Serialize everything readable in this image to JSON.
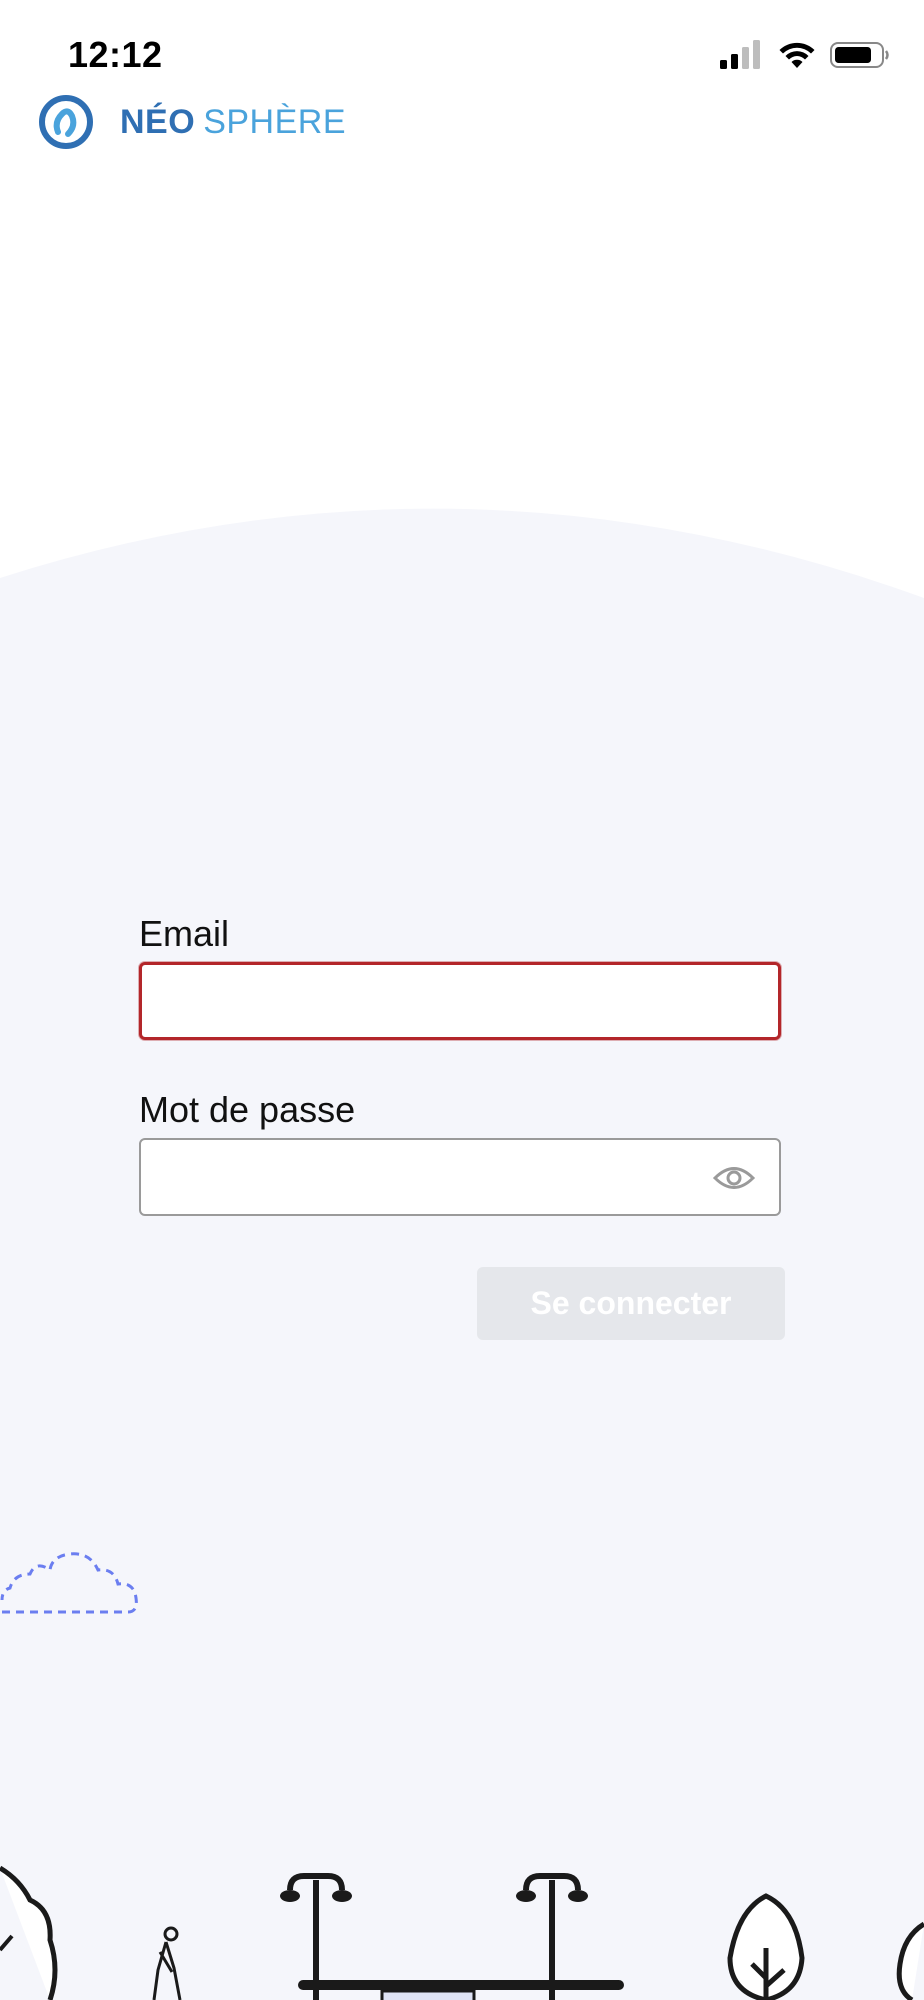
{
  "status_bar": {
    "time": "12:12",
    "icons": [
      "signal-icon",
      "wifi-icon",
      "battery-icon"
    ]
  },
  "brand": {
    "name_part1": "NÉO",
    "name_part2": "SPHÈRE",
    "primary_color": "#2f6fb3",
    "secondary_color": "#4aa3dc"
  },
  "login_form": {
    "email_label": "Email",
    "email_value": "",
    "email_state": "error",
    "password_label": "Mot de passe",
    "password_value": "",
    "password_toggle_icon": "eye-icon",
    "submit_label": "Se connecter",
    "submit_state": "disabled"
  },
  "colors": {
    "background_light": "#f5f6fb",
    "error_border": "#b3262a",
    "disabled_button": "#e5e7eb"
  }
}
